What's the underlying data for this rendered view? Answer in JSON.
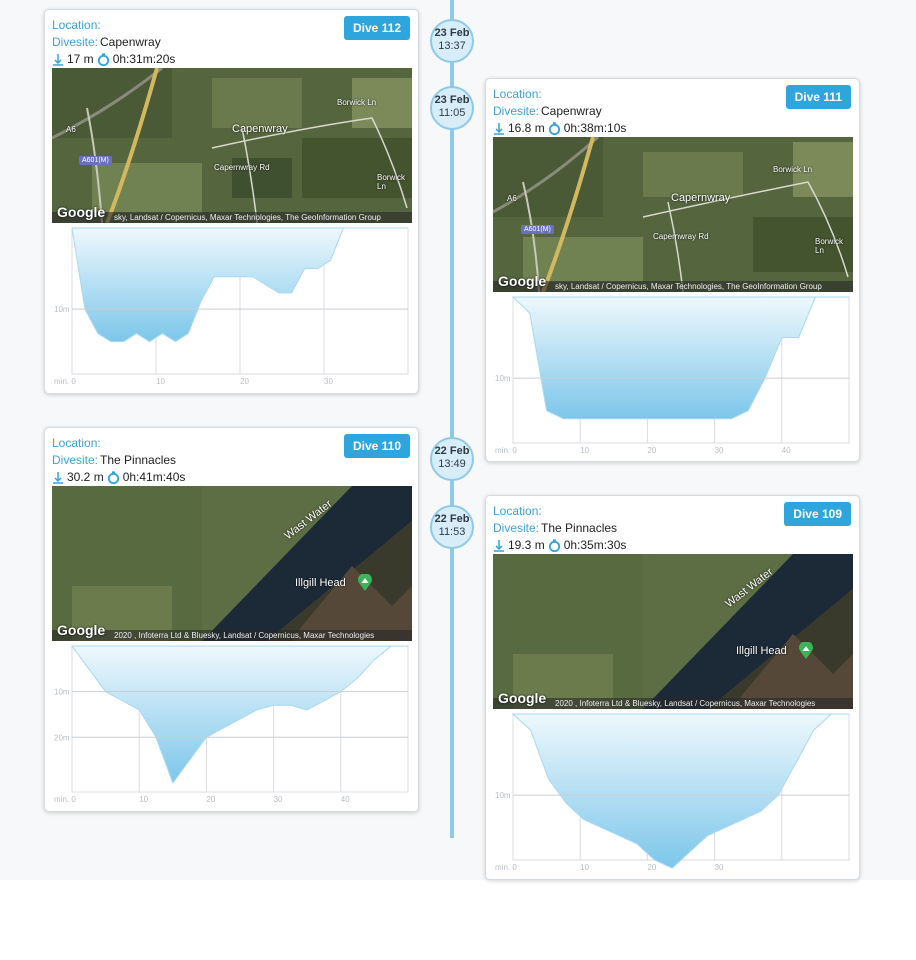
{
  "labels": {
    "location": "Location:",
    "divesite": "Divesite:"
  },
  "nav_timeline": [
    {
      "date": "23 Feb",
      "time": "13:37"
    },
    {
      "date": "23 Feb",
      "time": "11:05"
    },
    {
      "date": "22 Feb",
      "time": "13:49"
    },
    {
      "date": "22 Feb",
      "time": "11:53"
    }
  ],
  "dives": [
    {
      "badge": "Dive 112",
      "location": "",
      "divesite": "Capenwray",
      "depth": "17 m",
      "duration": "0h:31m:20s",
      "map": {
        "provider": "Google",
        "attribution": "sky, Landsat / Copernicus, Maxar Technologies, The GeoInformation Group",
        "place": "Capenwray",
        "roads": [
          "A6",
          "Capernwray Rd",
          "Borwick Ln",
          "Borwick Ln"
        ],
        "shield": "A601(M)"
      },
      "profile": {
        "y_ticks": [
          "10m"
        ],
        "x_ticks": [
          "min. 0",
          "10",
          "20",
          "30"
        ],
        "depths": [
          0,
          10,
          13,
          14,
          14,
          13,
          14,
          13,
          14,
          13,
          9,
          6,
          6,
          6,
          6,
          7,
          8,
          8,
          5,
          5,
          4,
          0,
          0,
          0,
          0,
          0,
          0
        ]
      }
    },
    {
      "badge": "Dive 111",
      "location": "",
      "divesite": "Capenwray",
      "depth": "16.8 m",
      "duration": "0h:38m:10s",
      "map": {
        "provider": "Google",
        "attribution": "sky, Landsat / Copernicus, Maxar Technologies, The GeoInformation Group",
        "place": "Capernwray",
        "roads": [
          "A6",
          "Capernwray Rd",
          "Borwick Ln",
          "Borwick Ln"
        ],
        "shield": "A601(M)"
      },
      "profile": {
        "y_ticks": [
          "10m"
        ],
        "x_ticks": [
          "min. 0",
          "10",
          "20",
          "30",
          "40"
        ],
        "depths": [
          0,
          2,
          14,
          15,
          15,
          15,
          15,
          15,
          15,
          15,
          15,
          15,
          15,
          15,
          14,
          10,
          5,
          5,
          0,
          0,
          0
        ]
      }
    },
    {
      "badge": "Dive 110",
      "location": "",
      "divesite": "The Pinnacles",
      "depth": "30.2 m",
      "duration": "0h:41m:40s",
      "map": {
        "provider": "Google",
        "attribution": "2020 , Infoterra Ltd & Bluesky, Landsat / Copernicus, Maxar Technologies",
        "lake": "Wast Water",
        "peak": "Illgill Head"
      },
      "profile": {
        "y_ticks": [
          "10m",
          "20m"
        ],
        "x_ticks": [
          "min. 0",
          "10",
          "20",
          "30",
          "40"
        ],
        "depths": [
          0,
          5,
          10,
          12,
          14,
          20,
          30,
          25,
          20,
          18,
          16,
          14,
          13,
          13,
          14,
          12,
          10,
          7,
          3,
          0,
          0
        ]
      }
    },
    {
      "badge": "Dive 109",
      "location": "",
      "divesite": "The Pinnacles",
      "depth": "19.3 m",
      "duration": "0h:35m:30s",
      "map": {
        "provider": "Google",
        "attribution": "2020 , Infoterra Ltd & Bluesky, Landsat / Copernicus, Maxar Technologies",
        "lake": "Wast Water",
        "peak": "Illgill Head"
      },
      "profile": {
        "y_ticks": [
          "10m"
        ],
        "x_ticks": [
          "min. 0",
          "10",
          "20",
          "30",
          ""
        ],
        "depths": [
          0,
          2,
          8,
          11,
          13,
          14,
          15,
          16,
          18,
          19,
          17,
          15,
          14,
          13,
          12,
          10,
          6,
          2,
          0,
          0
        ]
      }
    }
  ]
}
